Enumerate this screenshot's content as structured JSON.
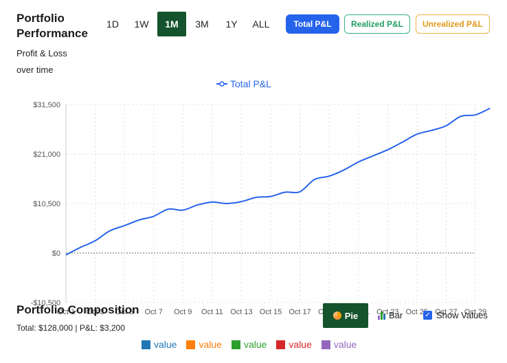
{
  "header": {
    "title": "Portfolio Performance",
    "subtitle": "Profit & Loss over time"
  },
  "ranges": [
    {
      "label": "1D",
      "active": false
    },
    {
      "label": "1W",
      "active": false
    },
    {
      "label": "1M",
      "active": true
    },
    {
      "label": "3M",
      "active": false
    },
    {
      "label": "1Y",
      "active": false
    },
    {
      "label": "ALL",
      "active": false
    }
  ],
  "modes": {
    "total": "Total P&L",
    "realized": "Realized P&L",
    "unrealized": "Unrealized P&L"
  },
  "chart_data": {
    "type": "line",
    "legend": "Total P&L",
    "series_color": "#2563eb",
    "ylim": [
      -10500,
      31500
    ],
    "yticks": [
      "$31,500",
      "$21,000",
      "$10,500",
      "$0",
      "-$10,500"
    ],
    "ytick_values": [
      31500,
      21000,
      10500,
      0,
      -10500
    ],
    "x_ticks": [
      "Oct 1",
      "Oct 3",
      "Oct 5",
      "Oct 7",
      "Oct 9",
      "Oct 11",
      "Oct 13",
      "Oct 15",
      "Oct 17",
      "Oct 19",
      "Oct 21",
      "Oct 23",
      "Oct 25",
      "Oct 27",
      "Oct 29"
    ],
    "x": [
      0,
      0.5,
      1,
      1.5,
      2,
      2.5,
      3,
      3.5,
      4,
      4.5,
      5,
      5.5,
      6,
      6.5,
      7,
      7.5,
      8,
      8.5,
      9,
      9.5,
      10,
      10.5,
      11,
      11.5,
      12,
      12.5,
      13,
      13.5,
      14,
      14.5
    ],
    "values": [
      -400,
      1200,
      2600,
      4700,
      5800,
      7000,
      7800,
      9300,
      9100,
      10200,
      10800,
      10500,
      10900,
      11800,
      12000,
      12900,
      13000,
      15600,
      16300,
      17600,
      19300,
      20600,
      21900,
      23500,
      25200,
      26000,
      27000,
      29000,
      29300,
      30700
    ],
    "grid": true
  },
  "composition": {
    "title": "Portfolio Composition",
    "summary": "Total: $128,000 | P&L: $3,200",
    "pie_label": "Pie",
    "bar_label": "Bar",
    "show_values_label": "Show Values",
    "legend": [
      {
        "label": "value",
        "color": "#1f77b4"
      },
      {
        "label": "value",
        "color": "#ff7f0e"
      },
      {
        "label": "value",
        "color": "#2ca02c"
      },
      {
        "label": "value",
        "color": "#d62728"
      },
      {
        "label": "value",
        "color": "#9467bd"
      }
    ]
  }
}
